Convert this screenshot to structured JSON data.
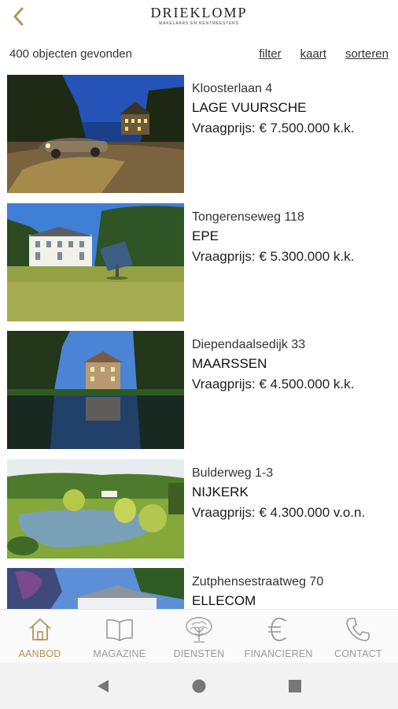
{
  "header": {
    "brand": "DRIEKLOMP",
    "tagline": "MAKELAARS EN RENTMEESTERS",
    "accent_color": "#b19559",
    "back_icon": "chevron-left-icon"
  },
  "toolbar": {
    "count_label": "400 objecten gevonden",
    "filter_label": "filter",
    "map_label": "kaart",
    "sort_label": "sorteren"
  },
  "listings": [
    {
      "street": "Kloosterlaan 4",
      "city": "LAGE VUURSCHE",
      "price": "Vraagprijs: € 7.500.000 k.k."
    },
    {
      "street": "Tongerenseweg 118",
      "city": "EPE",
      "price": "Vraagprijs: € 5.300.000 k.k."
    },
    {
      "street": "Diependaalsedijk 33",
      "city": "MAARSSEN",
      "price": "Vraagprijs: € 4.500.000 k.k."
    },
    {
      "street": "Bulderweg 1-3",
      "city": "NIJKERK",
      "price": "Vraagprijs: € 4.300.000 v.o.n."
    },
    {
      "street": "Zutphensestraatweg 70",
      "city": "ELLECOM",
      "price": ""
    }
  ],
  "tabs": [
    {
      "label": "AANBOD",
      "icon": "house-icon",
      "active": true
    },
    {
      "label": "MAGAZINE",
      "icon": "book-icon",
      "active": false
    },
    {
      "label": "DIENSTEN",
      "icon": "tree-icon",
      "active": false
    },
    {
      "label": "FINANCIEREN",
      "icon": "euro-icon",
      "active": false
    },
    {
      "label": "CONTACT",
      "icon": "phone-icon",
      "active": false
    }
  ],
  "system_nav": {
    "back": "back-triangle-icon",
    "home": "home-circle-icon",
    "recents": "recents-square-icon"
  }
}
